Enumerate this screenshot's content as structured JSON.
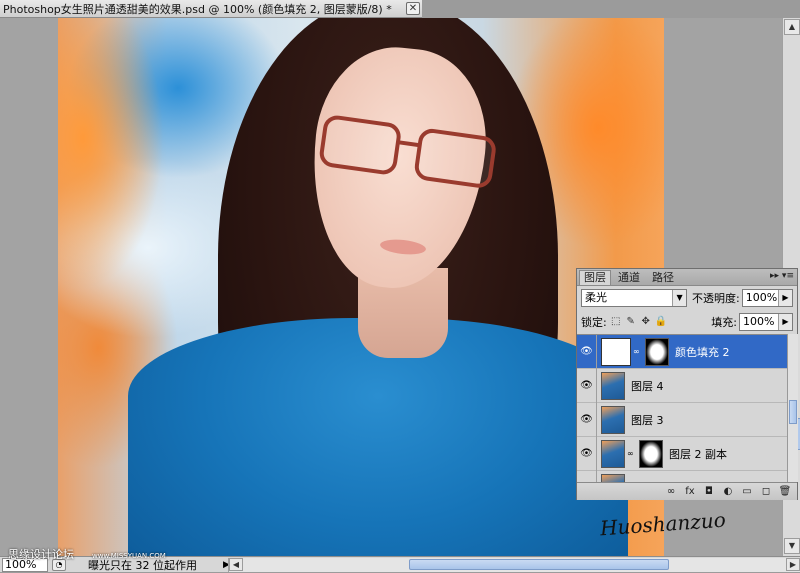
{
  "document": {
    "title": "Photoshop女生照片通透甜美的效果.psd @ 100% (颜色填充 2, 图层蒙版/8) *",
    "close_glyph": "✕"
  },
  "canvas": {
    "signature": "Huoshanzuo"
  },
  "statusbar": {
    "zoom": "100%",
    "info_text": "曝光只在 32 位起作用",
    "menu_arrow": "▶",
    "site_label": "思缘设计论坛",
    "site_url": "www.MISSYUAN.COM"
  },
  "layers_panel": {
    "tabs": [
      {
        "label": "图层",
        "active": true
      },
      {
        "label": "通道",
        "active": false
      },
      {
        "label": "路径",
        "active": false
      }
    ],
    "panel_buttons": "▸▸ ▾≡",
    "blend_mode": "柔光",
    "opacity_label": "不透明度:",
    "opacity_value": "100%",
    "lock_label": "锁定:",
    "fill_label": "填充:",
    "fill_value": "100%",
    "layers": [
      {
        "name": "颜色填充 2",
        "selected": true
      },
      {
        "name": "图层 4",
        "selected": false
      },
      {
        "name": "图层 3",
        "selected": false
      },
      {
        "name": "图层 2 副本",
        "selected": false
      },
      {
        "name": "",
        "selected": false
      }
    ],
    "footer_icons": [
      "link-icon",
      "fx-icon",
      "mask-icon",
      "adjustment-icon",
      "group-icon",
      "new-layer-icon",
      "trash-icon"
    ],
    "footer_glyphs": [
      "∞",
      "fx",
      "◘",
      "◐",
      "▭",
      "◻",
      "🗑"
    ]
  },
  "icons": {
    "eye": "👁",
    "link": "∞",
    "lock_glyphs": [
      "⬚",
      "✎",
      "✥",
      "🔒"
    ],
    "dropdown": "▼",
    "right_arrow": "▶",
    "left_arrow": "◀",
    "up_arrow": "▲",
    "down_arrow": "▼"
  },
  "colors": {
    "selection": "#3169c6",
    "panel_bg": "#d6d6d6",
    "canvas_bg": "#a3a3a3"
  }
}
